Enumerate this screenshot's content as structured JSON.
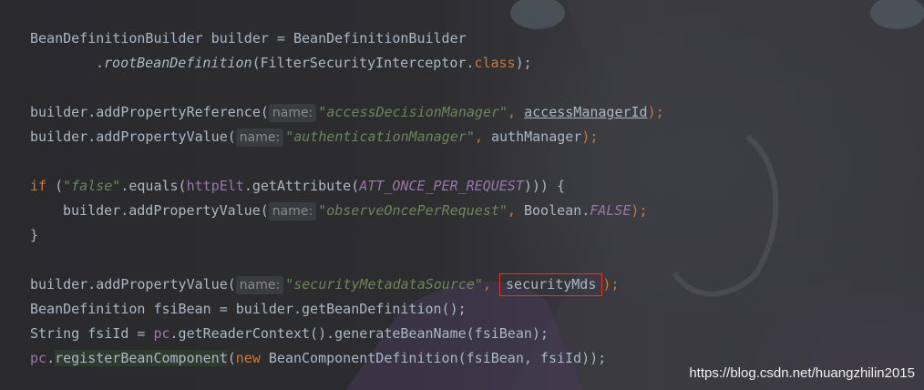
{
  "code": {
    "l1": {
      "a": "BeanDefinitionBuilder builder = BeanDefinitionBuilder"
    },
    "l2": {
      "dot": ".",
      "method": "rootBeanDefinition",
      "open": "(FilterSecurityInterceptor.",
      "cls": "class",
      "close": ");"
    },
    "l3": {
      "a": "builder.addPropertyReference(",
      "hint": "name:",
      "str": "\"accessDecisionManager\"",
      "comma": ", ",
      "arg": "accessManagerId",
      "end": ");"
    },
    "l4": {
      "a": "builder.addPropertyValue(",
      "hint": "name:",
      "str": "\"authenticationManager\"",
      "comma": ", ",
      "arg": "authManager",
      "end": ");"
    },
    "l5": {
      "kw": "if",
      "p1": " (",
      "str": "\"false\"",
      "a": ".equals(",
      "field": "httpElt",
      "b": ".getAttribute(",
      "const": "ATT_ONCE_PER_REQUEST",
      "c": "))) {"
    },
    "l6": {
      "a": "builder.addPropertyValue(",
      "hint": "name:",
      "str": "\"observeOncePerRequest\"",
      "comma": ", ",
      "arg": "Boolean.",
      "const": "FALSE",
      "end": ");"
    },
    "l7": {
      "a": "}"
    },
    "l8": {
      "a": "builder.addPropertyValue(",
      "hint": "name:",
      "str": "\"securityMetadataSource\"",
      "comma": ", ",
      "arg": "securityMds",
      "end": ");"
    },
    "l9": {
      "a": "BeanDefinition fsiBean = builder.getBeanDefinition();"
    },
    "l10": {
      "a": "String fsiId = ",
      "field": "pc",
      "b": ".getReaderContext().generateBeanName(fsiBean);"
    },
    "l11": {
      "field": "pc",
      "dot": ".",
      "method": "registerBeanComponent",
      "kw": "new",
      "b": " BeanComponentDefinition(fsiBean, fsiId));"
    }
  },
  "watermark": "https://blog.csdn.net/huangzhilin2015",
  "colors": {
    "keyword": "#cc7832",
    "string": "#6a8759",
    "field": "#9876aa",
    "text": "#a9b7c6",
    "highlight_box": "#e0332f"
  }
}
